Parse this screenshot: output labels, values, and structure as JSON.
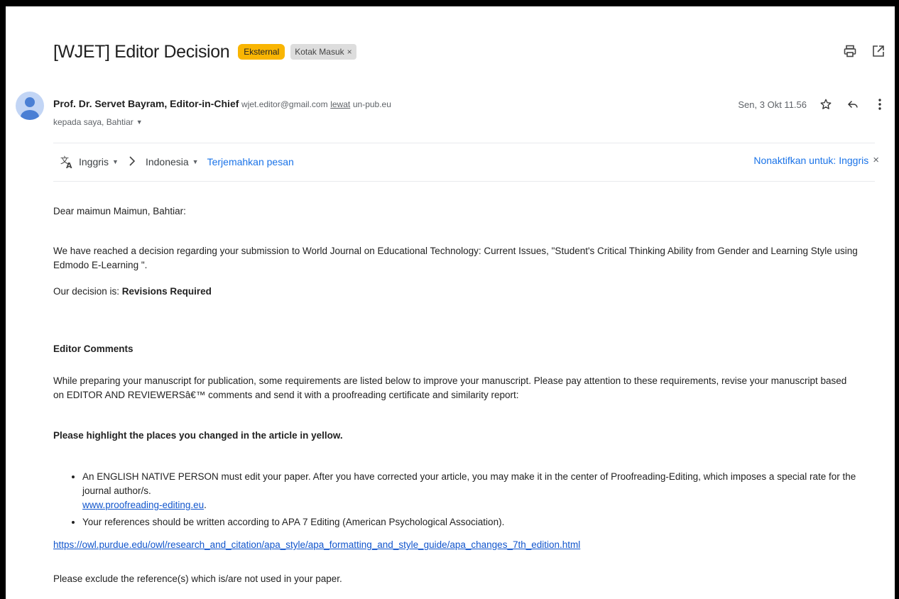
{
  "email": {
    "subject": "[WJET] Editor Decision",
    "labels": {
      "external": "Eksternal",
      "inbox": "Kotak Masuk",
      "inbox_close": "×"
    },
    "sender": {
      "name": "Prof. Dr. Servet Bayram, Editor-in-Chief",
      "email": "wjet.editor@gmail.com",
      "via_label": "lewat",
      "via_domain": "un-pub.eu",
      "to": "kepada saya, Bahtiar"
    },
    "date": "Sen, 3 Okt 11.56"
  },
  "translate": {
    "from_lang": "Inggris",
    "to_lang": "Indonesia",
    "translate_link": "Terjemahkan pesan",
    "disable_label": "Nonaktifkan untuk: Inggris",
    "disable_close": "×"
  },
  "body": {
    "greeting": "Dear   maimun Maimun, Bahtiar:",
    "para1": "We have reached a decision regarding your submission to World Journal on Educational Technology: Current Issues, \"Student's Critical Thinking Ability from Gender and Learning Style using Edmodo E-Learning \".",
    "decision_prefix": "Our decision is: ",
    "decision_value": "Revisions Required",
    "editor_comments_heading": "Editor Comments",
    "para2": "While preparing your manuscript for publication, some requirements are listed below to improve your manuscript. Please pay attention to these requirements, revise your manuscript based on EDITOR AND REVIEWERSâ€™ comments and send it with a proofreading certificate and similarity report:",
    "highlight_instruction": "Please highlight the places you changed in the article in yellow.",
    "bullet1": "An ENGLISH NATIVE PERSON must edit your paper. After you have corrected your article, you may make it in the center of Proofreading-Editing, which imposes a special rate for the journal author/s.",
    "bullet1_link": "www.proofreading-editing.eu",
    "bullet1_end": ".",
    "bullet2": "Your references should be written according to APA 7 Editing (American Psychological Association).",
    "apa_link": "https://owl.purdue.edu/owl/research_and_citation/apa_style/apa_formatting_and_style_guide/apa_changes_7th_edition.html",
    "para3": "Please exclude the reference(s) which is/are not used in your paper."
  },
  "colors": {
    "external_badge": "#f9b503",
    "link": "#1155cc",
    "translate_link": "#1a73e8"
  }
}
